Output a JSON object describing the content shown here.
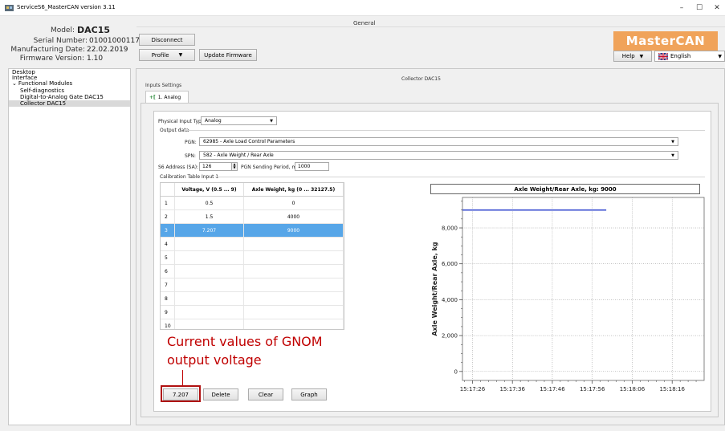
{
  "window": {
    "title": "ServiceS6_MasterCAN version 3.11",
    "minimize_icon": "minimize-icon",
    "maximize_icon": "maximize-icon",
    "close_icon": "close-icon"
  },
  "header": {
    "section_title": "General",
    "model_label": "Model:",
    "model_value": "DAC15",
    "serial_label": "Serial Number:",
    "serial_value": "01001000117",
    "manufacturing_label": "Manufacturing Date:",
    "manufacturing_value": "22.02.2019",
    "firmware_label": "Firmware Version:",
    "firmware_value": "1.10",
    "disconnect_label": "Disconnect",
    "profile_label": "Profile",
    "update_firmware_label": "Update Firmware",
    "logo_text": "MasterCAN",
    "help_label": "Help",
    "language_label": "English"
  },
  "tree": {
    "items": [
      {
        "label": "Desktop"
      },
      {
        "label": "Interface"
      },
      {
        "label": "Functional Modules"
      },
      {
        "label": "Self-diagnostics"
      },
      {
        "label": "Digital-to-Analog Gate DAC15"
      },
      {
        "label": "Collector DAC15"
      }
    ]
  },
  "main": {
    "title": "Collector DAC15",
    "inputs_settings_label": "Inputs Settings",
    "tab_label": "1. Analog",
    "physical_input_type_label": "Physical Input Type:",
    "physical_input_type_value": "Analog",
    "output_data_label": "Output data",
    "pgn_label": "PGN:",
    "pgn_value": "62985 - Axle Load Control Parameters",
    "spn_label": "SPN:",
    "spn_value": "582 - Axle Weight / Rear Axle",
    "s6_address_label": "S6 Address (SA):",
    "s6_address_value": "126",
    "pgn_period_label": "PGN Sending Period, ms:",
    "pgn_period_value": "1000",
    "calibration_label": "Calibration Table Input 1"
  },
  "table": {
    "headers": [
      "Voltage, V (0.5 ... 9)",
      "Axle Weight, kg (0 ... 32127.5)"
    ],
    "rows": [
      {
        "n": "1",
        "v": "0.5",
        "w": "0"
      },
      {
        "n": "2",
        "v": "1.5",
        "w": "4000"
      },
      {
        "n": "3",
        "v": "7.207",
        "w": "9000"
      },
      {
        "n": "4",
        "v": "",
        "w": ""
      },
      {
        "n": "5",
        "v": "",
        "w": ""
      },
      {
        "n": "6",
        "v": "",
        "w": ""
      },
      {
        "n": "7",
        "v": "",
        "w": ""
      },
      {
        "n": "8",
        "v": "",
        "w": ""
      },
      {
        "n": "9",
        "v": "",
        "w": ""
      },
      {
        "n": "10",
        "v": "",
        "w": ""
      }
    ],
    "selected_row": 2
  },
  "buttons": {
    "current_value": "7.207",
    "delete": "Delete",
    "clear": "Clear",
    "graph": "Graph"
  },
  "annotation": {
    "line1": "Current values of GNOM",
    "line2": "output voltage"
  },
  "colors": {
    "selected_row": "#57a6e8",
    "series_line": "#3b4fd1",
    "annotation": "#c00000",
    "logo_bg": "#f0a35a"
  },
  "chart_data": {
    "type": "line",
    "title": "Axle Weight/Rear Axle, kg: 9000",
    "xlabel": "",
    "ylabel": "Axle Weight/Rear Axle, kg",
    "ylim": [
      -500,
      9700
    ],
    "y_ticks": [
      0,
      2000,
      4000,
      6000,
      8000
    ],
    "y_tick_labels": [
      "0",
      "2,000",
      "4,000",
      "6,000",
      "8,000"
    ],
    "x_tick_labels": [
      "15:17:26",
      "15:17:36",
      "15:17:46",
      "15:17:56",
      "15:18:06",
      "15:18:16"
    ],
    "x_seconds": [
      0,
      10,
      20,
      30,
      40,
      50
    ],
    "xlim": [
      -2.5,
      58
    ],
    "grid": true,
    "series": [
      {
        "x": [
          -2.5,
          33.5
        ],
        "values": [
          9000,
          9000
        ]
      }
    ]
  }
}
